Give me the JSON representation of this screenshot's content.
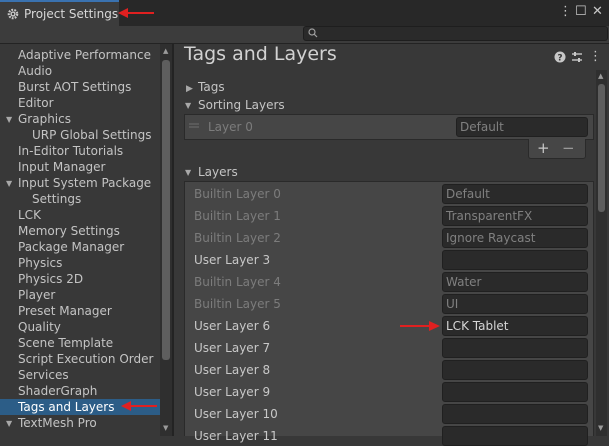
{
  "window": {
    "tab_title": "Project Settings",
    "controls": {
      "more": "⋮",
      "maximize": "☐",
      "close": "✕"
    }
  },
  "search": {
    "placeholder": "",
    "value": ""
  },
  "sidebar": {
    "items": [
      {
        "label": "Adaptive Performance",
        "indent": 0
      },
      {
        "label": "Audio",
        "indent": 0
      },
      {
        "label": "Burst AOT Settings",
        "indent": 0
      },
      {
        "label": "Editor",
        "indent": 0
      },
      {
        "label": "Graphics",
        "indent": 0,
        "foldout": "open"
      },
      {
        "label": "URP Global Settings",
        "indent": 1
      },
      {
        "label": "In-Editor Tutorials",
        "indent": 0
      },
      {
        "label": "Input Manager",
        "indent": 0
      },
      {
        "label": "Input System Package",
        "indent": 0,
        "foldout": "open"
      },
      {
        "label": "Settings",
        "indent": 1
      },
      {
        "label": "LCK",
        "indent": 0
      },
      {
        "label": "Memory Settings",
        "indent": 0
      },
      {
        "label": "Package Manager",
        "indent": 0
      },
      {
        "label": "Physics",
        "indent": 0
      },
      {
        "label": "Physics 2D",
        "indent": 0
      },
      {
        "label": "Player",
        "indent": 0
      },
      {
        "label": "Preset Manager",
        "indent": 0
      },
      {
        "label": "Quality",
        "indent": 0
      },
      {
        "label": "Scene Template",
        "indent": 0
      },
      {
        "label": "Script Execution Order",
        "indent": 0
      },
      {
        "label": "Services",
        "indent": 0
      },
      {
        "label": "ShaderGraph",
        "indent": 0
      },
      {
        "label": "Tags and Layers",
        "indent": 0,
        "selected": true
      },
      {
        "label": "TextMesh Pro",
        "indent": 0,
        "foldout": "open"
      }
    ]
  },
  "main": {
    "title": "Tags and Layers",
    "header_icons": [
      "help-icon",
      "presets-icon",
      "more-icon"
    ],
    "tags_label": "Tags",
    "sorting_layers_label": "Sorting Layers",
    "sorting_layer": {
      "name": "Layer 0",
      "value": "Default"
    },
    "add_button": "+",
    "remove_button": "−",
    "layers_label": "Layers",
    "layers": [
      {
        "label": "Builtin Layer 0",
        "value": "Default",
        "editable": false
      },
      {
        "label": "Builtin Layer 1",
        "value": "TransparentFX",
        "editable": false
      },
      {
        "label": "Builtin Layer 2",
        "value": "Ignore Raycast",
        "editable": false
      },
      {
        "label": "User Layer 3",
        "value": "",
        "editable": true
      },
      {
        "label": "Builtin Layer 4",
        "value": "Water",
        "editable": false
      },
      {
        "label": "Builtin Layer 5",
        "value": "UI",
        "editable": false
      },
      {
        "label": "User Layer 6",
        "value": "LCK Tablet",
        "editable": true
      },
      {
        "label": "User Layer 7",
        "value": "",
        "editable": true
      },
      {
        "label": "User Layer 8",
        "value": "",
        "editable": true
      },
      {
        "label": "User Layer 9",
        "value": "",
        "editable": true
      },
      {
        "label": "User Layer 10",
        "value": "",
        "editable": true
      },
      {
        "label": "User Layer 11",
        "value": "",
        "editable": true
      }
    ]
  },
  "annotation_color": "#e02020"
}
